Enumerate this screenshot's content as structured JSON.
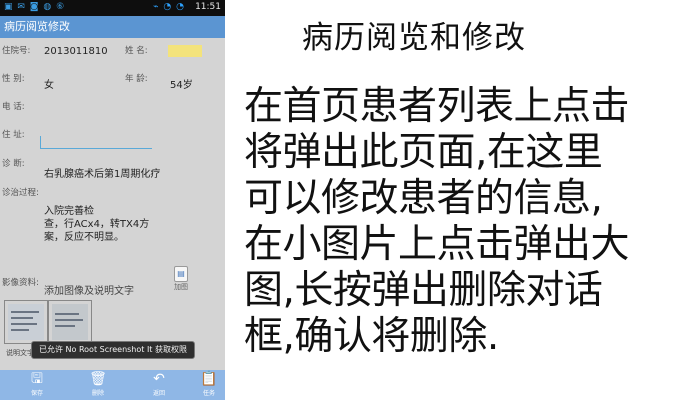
{
  "status_bar": {
    "left_icons": "▣ ✉ ◙ ◍ ⑥",
    "signal": "⌁ ◔ ◔",
    "time": "11:51"
  },
  "app": {
    "title": "病历阅览修改"
  },
  "form": {
    "hospital_no_label": "住院号:",
    "hospital_no_value": "2013011810",
    "name_label": "姓 名:",
    "name_value": "",
    "gender_label": "性 别:",
    "gender_value": "女",
    "age_label": "年 龄:",
    "age_value": "54岁",
    "phone_label": "电 话:",
    "address_label": "住 址:",
    "diagnosis_label": "诊 断:",
    "diagnosis_value": "右乳腺癌术后第1周期化疗",
    "treatment_label": "诊治过程:",
    "treatment_lines": [
      "入院完善检",
      "查，行ACx4，转TX4方",
      "案，反应不明显。"
    ],
    "images_label": "影像资料:",
    "images_placeholder": "添加图像及说明文字",
    "add_button_label": "加图",
    "thumb_caption": "说明文字"
  },
  "toast": "已允许 No Root Screenshot It 获取权限",
  "bottom_bar": {
    "save_label": "保存",
    "delete_label": "删除",
    "back_label": "返回",
    "tasks_label": "任务"
  },
  "colors": {
    "titlebar": "#5b95d2",
    "bottombar": "#8fb7e6",
    "background": "#d4d4d4"
  },
  "description": {
    "title": "病历阅览和修改",
    "lines": [
      "在首页患者列表上点击",
      "将弹出此页面,在这里",
      "可以修改患者的信息,",
      "在小图片上点击弹出大",
      "图,长按弹出删除对话",
      "框,确认将删除."
    ]
  }
}
